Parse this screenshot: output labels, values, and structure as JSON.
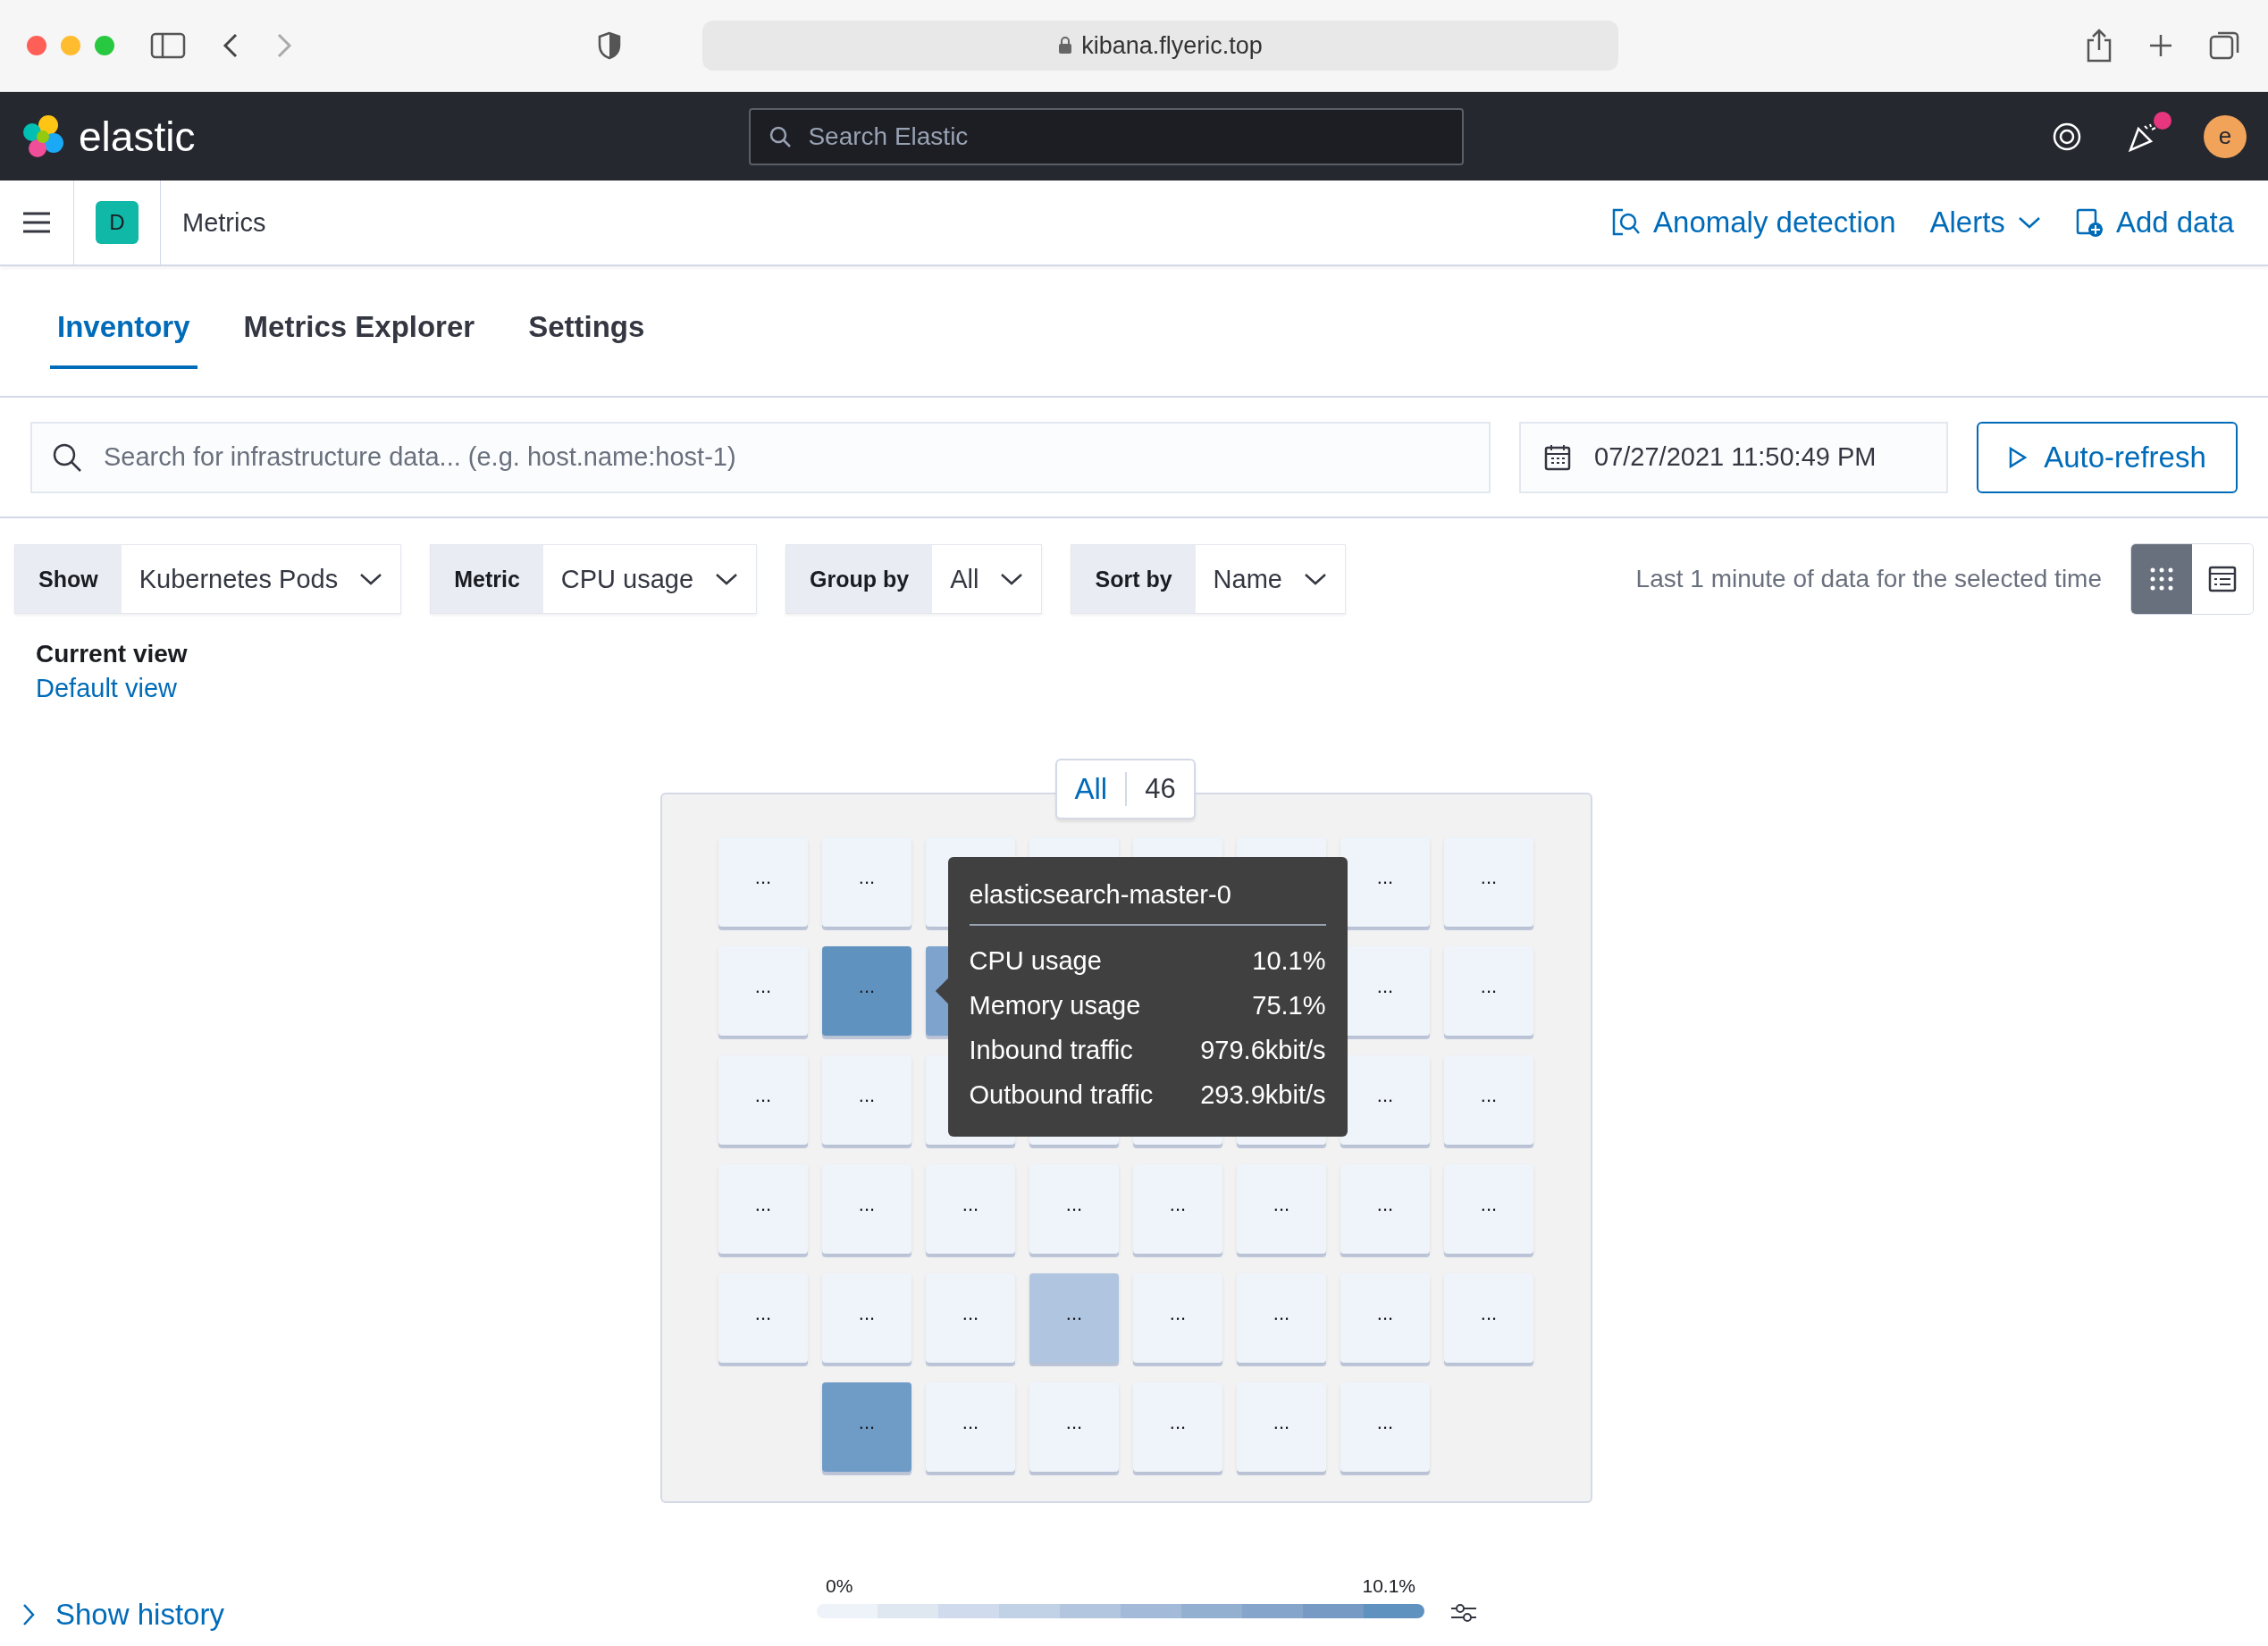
{
  "browser": {
    "url": "kibana.flyeric.top"
  },
  "header": {
    "brand": "elastic",
    "search_placeholder": "Search Elastic",
    "avatar": "e",
    "notification": true
  },
  "breadcrumb": {
    "space": "D",
    "title": "Metrics",
    "actions": [
      {
        "kind": "anomaly",
        "label": "Anomaly detection"
      },
      {
        "kind": "menu",
        "label": "Alerts"
      },
      {
        "kind": "add",
        "label": "Add data"
      }
    ]
  },
  "tabs": [
    {
      "label": "Inventory",
      "selected": true
    },
    {
      "label": "Metrics Explorer",
      "selected": false
    },
    {
      "label": "Settings",
      "selected": false
    }
  ],
  "query": {
    "placeholder": "Search for infrastructure data... (e.g. host.name:host-1)",
    "date": "07/27/2021 11:50:49 PM",
    "refresh": "Auto-refresh"
  },
  "filters": [
    {
      "label": "Show",
      "value": "Kubernetes Pods"
    },
    {
      "label": "Metric",
      "value": "CPU usage"
    },
    {
      "label": "Group by",
      "value": "All"
    },
    {
      "label": "Sort by",
      "value": "Name"
    }
  ],
  "time_note": "Last 1 minute of data for the selected time",
  "views": [
    {
      "kind": "map",
      "selected": true
    },
    {
      "kind": "table",
      "selected": false
    }
  ],
  "saved_view": {
    "title": "Current view",
    "link": "Default view"
  },
  "group": {
    "name": "All",
    "count": "46"
  },
  "tiles": [
    [
      {
        "color": "#eff3fa",
        "label": "..."
      },
      {
        "color": "#eff3fa",
        "label": "..."
      },
      {
        "color": "#eff3fa"
      },
      {
        "color": "#eff3fa"
      },
      {
        "color": "#eff3fa"
      },
      {
        "color": "#eff3fa"
      },
      {
        "color": "#eff3fa",
        "label": "..."
      },
      {
        "color": "#eff3fa",
        "label": "..."
      }
    ],
    {
      "cells": [
        {
          "color": "#eff3fa",
          "label": "..."
        },
        {
          "color": "#6092c0",
          "label": "..."
        },
        {
          "color": "#7ea3cc"
        }
      ],
      "cells_after_tooltip": [
        {
          "color": "#eff3fa",
          "label": "..."
        },
        {
          "color": "#eff3fa",
          "label": "..."
        }
      ]
    },
    [
      {
        "color": "#eff3fa",
        "label": "..."
      },
      {
        "color": "#eff3fa",
        "label": "..."
      },
      {
        "color": "#eff3fa"
      },
      {
        "color": "#eff3fa"
      },
      {
        "color": "#eff3fa"
      },
      {
        "color": "#eff3fa"
      },
      {
        "color": "#eff3fa",
        "label": "..."
      },
      {
        "color": "#eff3fa",
        "label": "..."
      }
    ],
    [
      {
        "color": "#eff3fa",
        "label": "..."
      },
      {
        "color": "#eff3fa",
        "label": "..."
      },
      {
        "color": "#eff3fa",
        "label": "..."
      },
      {
        "color": "#eff3fa",
        "label": "..."
      },
      {
        "color": "#eff3fa",
        "label": "..."
      },
      {
        "color": "#eff3fa",
        "label": "..."
      },
      {
        "color": "#eff3fa",
        "label": "..."
      },
      {
        "color": "#eff3fa",
        "label": "..."
      }
    ],
    [
      {
        "color": "#eff3fa",
        "label": "..."
      },
      {
        "color": "#eff3fa",
        "label": "..."
      },
      {
        "color": "#eff3fa",
        "label": "..."
      },
      {
        "color": "#b0c5df",
        "label": "..."
      },
      {
        "color": "#eff3fa",
        "label": "..."
      },
      {
        "color": "#eff3fa",
        "label": "..."
      },
      {
        "color": "#eff3fa",
        "label": "..."
      },
      {
        "color": "#eff3fa",
        "label": "..."
      }
    ],
    [
      {
        "color": "#6f9bc7",
        "label": "..."
      },
      {
        "color": "#eff3fa",
        "label": "..."
      },
      {
        "color": "#eff3fa",
        "label": "..."
      },
      {
        "color": "#eff3fa",
        "label": "..."
      },
      {
        "color": "#eff3fa",
        "label": "..."
      },
      {
        "color": "#eff3fa",
        "label": "..."
      }
    ]
  ],
  "tooltip": {
    "title": "elasticsearch-master-0",
    "rows": [
      {
        "label": "CPU usage",
        "value": "10.1%"
      },
      {
        "label": "Memory usage",
        "value": "75.1%"
      },
      {
        "label": "Inbound traffic",
        "value": "979.6kbit/s"
      },
      {
        "label": "Outbound traffic",
        "value": "293.9kbit/s"
      }
    ]
  },
  "history": "Show history",
  "legend": {
    "min": "0%",
    "max": "10.1%"
  }
}
